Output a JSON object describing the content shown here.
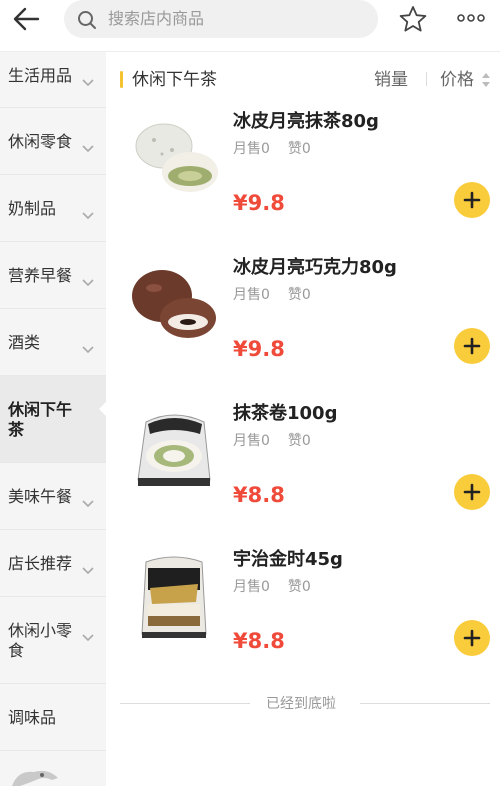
{
  "header": {
    "search_placeholder": "搜索店内商品",
    "back_icon": "back-arrow-icon",
    "favorite_icon": "star-icon",
    "more_icon": "more-dots-icon"
  },
  "sidebar": {
    "items": [
      {
        "label": "生活用品"
      },
      {
        "label": "休闲零食"
      },
      {
        "label": "奶制品"
      },
      {
        "label": "营养早餐"
      },
      {
        "label": "酒类"
      },
      {
        "label": "休闲下午茶",
        "active": true
      },
      {
        "label": "美味午餐"
      },
      {
        "label": "店长推荐"
      },
      {
        "label": "休闲小零食"
      },
      {
        "label": "调味品"
      }
    ]
  },
  "section": {
    "title": "休闲下午茶",
    "sort_sales": "销量",
    "sort_price": "价格"
  },
  "products": [
    {
      "name": "冰皮月亮抹茶80g",
      "sold": "月售0",
      "likes": "赞0",
      "price": "¥9.8"
    },
    {
      "name": "冰皮月亮巧克力80g",
      "sold": "月售0",
      "likes": "赞0",
      "price": "¥9.8"
    },
    {
      "name": "抹茶卷100g",
      "sold": "月售0",
      "likes": "赞0",
      "price": "¥8.8"
    },
    {
      "name": "宇治金时45g",
      "sold": "月售0",
      "likes": "赞0",
      "price": "¥8.8"
    }
  ],
  "footer": {
    "end_text": "已经到底啦"
  },
  "colors": {
    "accent": "#f8cc3b",
    "price": "#f04a3a"
  }
}
